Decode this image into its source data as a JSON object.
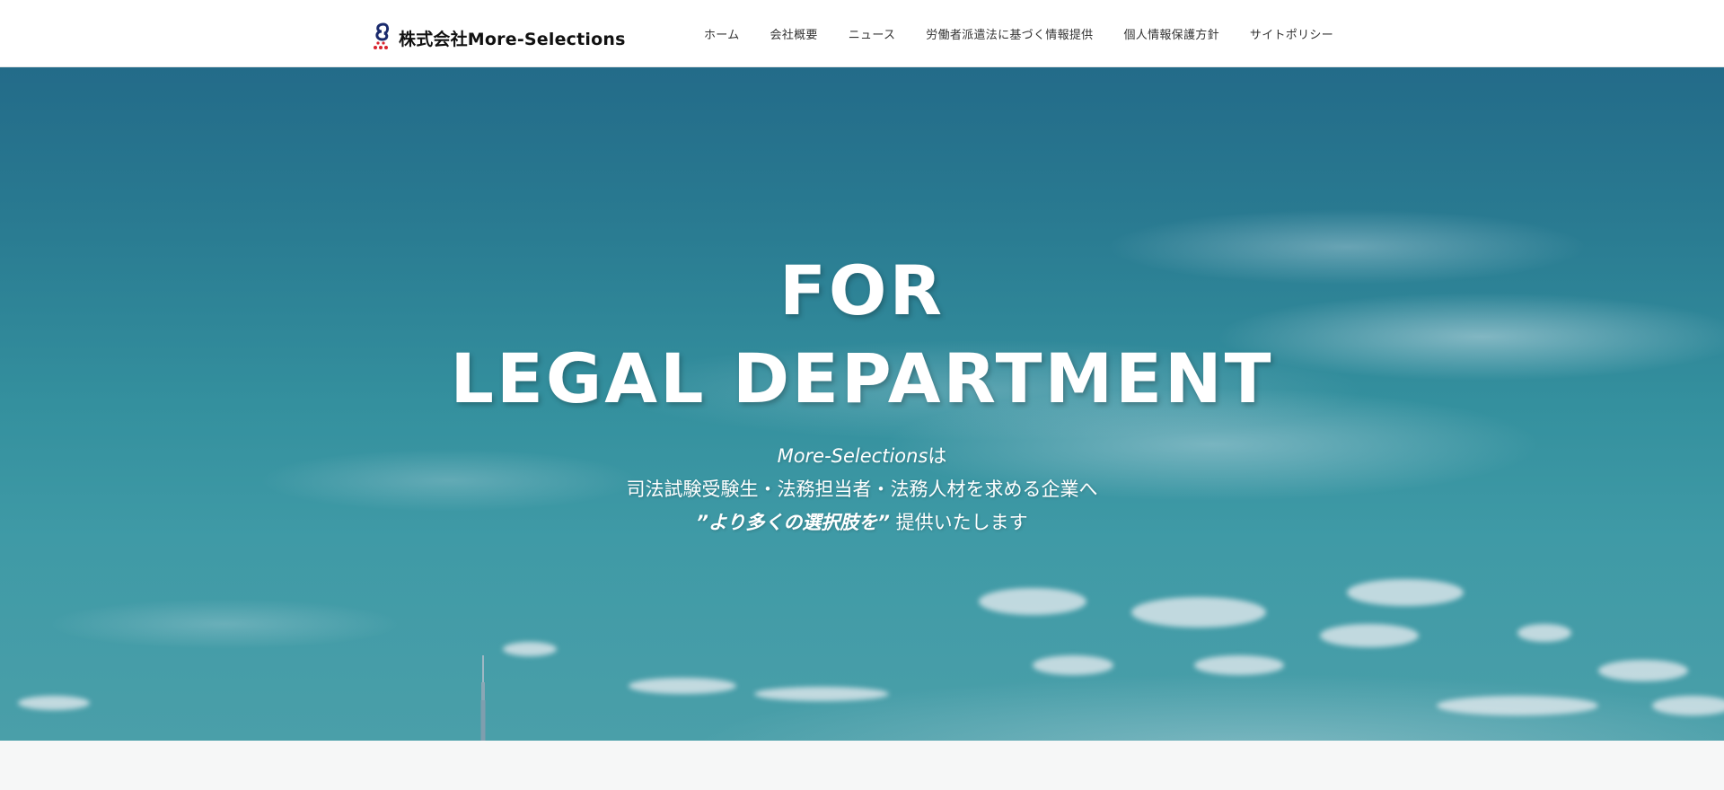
{
  "header": {
    "brand_name": "株式会社More-Selections",
    "nav": [
      {
        "label": "ホーム"
      },
      {
        "label": "会社概要"
      },
      {
        "label": "ニュース"
      },
      {
        "label": "労働者派遣法に基づく情報提供"
      },
      {
        "label": "個人情報保護方針"
      },
      {
        "label": "サイトポリシー"
      }
    ]
  },
  "hero": {
    "title_line1": "FOR",
    "title_line2": "LEGAL DEPARTMENT",
    "sub_brand": "More-Selections",
    "sub_particle": "は",
    "sub_line2": "司法試験受験生・法務担当者・法務人材を求める企業へ",
    "sub_emph": "”より多くの選択肢を”",
    "sub_tail": " 提供いたします"
  },
  "colors": {
    "sky_top": "#236b89",
    "sky_bottom": "#4a9fa9",
    "logo_navy": "#1a2a6c",
    "logo_red": "#d9232e"
  }
}
